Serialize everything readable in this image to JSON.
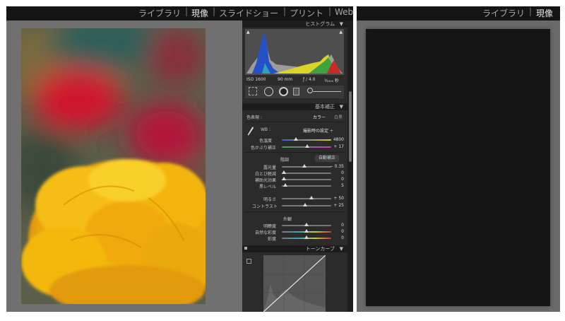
{
  "left": {
    "modules": [
      "ライブラリ",
      "現像",
      "スライドショー",
      "プリント",
      "Web"
    ],
    "active_module": "現像",
    "histogram": {
      "title": "ヒストグラム",
      "iso": "ISO 1600",
      "focal": "90 mm",
      "aperture": "ƒ / 4.0",
      "shutter": "¹⁄₂₅₀₀ 秒"
    },
    "basic": {
      "title": "基本補正",
      "treatment_label": "色表現 :",
      "treatment_color": "カラー",
      "treatment_bw": "白黒",
      "wb_label": "WB :",
      "wb_value": "撮影時の設定 ÷",
      "temp_label": "色温度",
      "temp_value": "4800",
      "tint_label": "色かぶり補正",
      "tint_value": "+ 17",
      "tone_label": "階調",
      "auto_button": "自動補正",
      "exposure_label": "露光量",
      "exposure_value": "− 0.35",
      "recovery_label": "白とび軽減",
      "recovery_value": "0",
      "fill_label": "補助光効果",
      "fill_value": "0",
      "blacks_label": "黒レベル",
      "blacks_value": "5",
      "brightness_label": "明るさ",
      "brightness_value": "+ 50",
      "contrast_label": "コントラスト",
      "contrast_value": "+ 25",
      "presence_label": "外観",
      "clarity_label": "明瞭度",
      "clarity_value": "0",
      "vibrance_label": "自然な彩度",
      "vibrance_value": "0",
      "saturation_label": "彩度",
      "saturation_value": "0"
    },
    "tone_curve": {
      "title": "トーンカーブ"
    }
  },
  "right": {
    "modules": [
      "ライブラリ",
      "現像"
    ],
    "active_module": "現像"
  }
}
